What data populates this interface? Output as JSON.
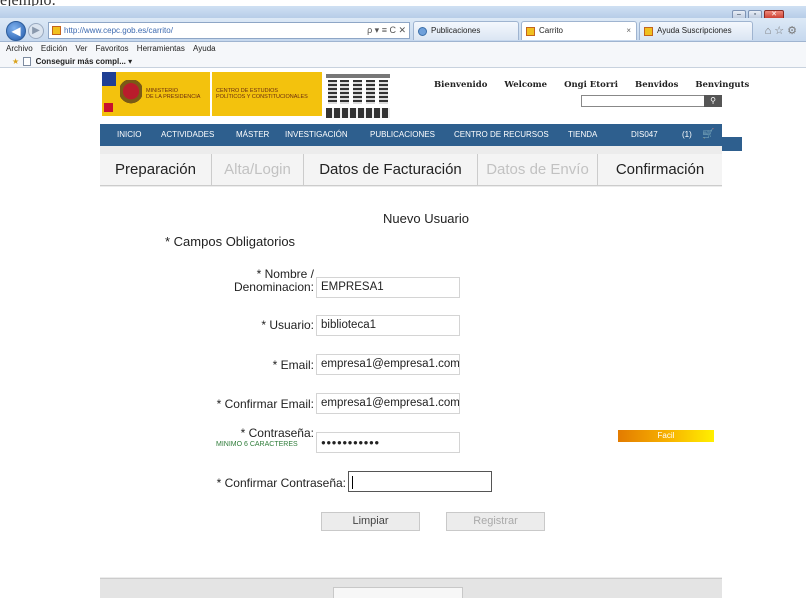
{
  "doc": {
    "fragment": "ejemplo:"
  },
  "browser": {
    "address_url": "http://www.cepc.gob.es/carrito/",
    "address_tools": "ρ ▾ ≡ C ✕",
    "tabs": [
      {
        "label": "Publicaciones"
      },
      {
        "label": "Carrito"
      },
      {
        "label": "Ayuda Suscripciones"
      }
    ],
    "tab_close": "×",
    "menu": [
      "Archivo",
      "Edición",
      "Ver",
      "Favoritos",
      "Herramientas",
      "Ayuda"
    ],
    "favorites": {
      "item": "Conseguir más compl...",
      "arrow": "▾"
    }
  },
  "site": {
    "logo_ministerio_text": "MINISTERIO\nDE LA PRESIDENCIA",
    "logo_cepc_text": "CENTRO DE ESTUDIOS\nPOLÍTICOS Y CONSTITUCIONALES",
    "languages": [
      "Bienvenido",
      "Welcome",
      "Ongi Etorri",
      "Benvidos",
      "Benvinguts"
    ],
    "search_icon": "search-icon",
    "nav": [
      "INICIO",
      "ACTIVIDADES",
      "MÁSTER",
      "INVESTIGACIÓN",
      "PUBLICACIONES",
      "CENTRO DE RECURSOS",
      "TIENDA"
    ],
    "user": "DIS047",
    "cart_count": "(1)",
    "nav_color": "#2e5f8e"
  },
  "steps": [
    {
      "label": "Preparación",
      "state": "enabled"
    },
    {
      "label": "Alta/Login",
      "state": "disabled"
    },
    {
      "label": "Datos de Facturación",
      "state": "enabled"
    },
    {
      "label": "Datos de Envío",
      "state": "disabled"
    },
    {
      "label": "Confirmación",
      "state": "enabled"
    }
  ],
  "form": {
    "title": "Nuevo Usuario",
    "required_note": "* Campos Obligatorios",
    "fields": {
      "nombre": {
        "label_line1": "* Nombre /",
        "label_line2": "Denominacion:",
        "value": "EMPRESA1"
      },
      "usuario": {
        "label": "* Usuario:",
        "value": "biblioteca1"
      },
      "email": {
        "label": "* Email:",
        "value": "empresa1@empresa1.com"
      },
      "confirm_email": {
        "label": "* Confirmar Email:",
        "value": "empresa1@empresa1.com"
      },
      "password": {
        "label": "* Contraseña:",
        "hint": "MINIMO 6 CARACTERES",
        "value": "●●●●●●●●●●●"
      },
      "confirm_password": {
        "label": "* Confirmar Contraseña:",
        "value": ""
      }
    },
    "strength": {
      "label": "Facil",
      "colors": [
        "#e37b00",
        "#f8b500",
        "#fff000"
      ]
    },
    "buttons": {
      "clear": "Limpiar",
      "register": "Registrar"
    }
  }
}
